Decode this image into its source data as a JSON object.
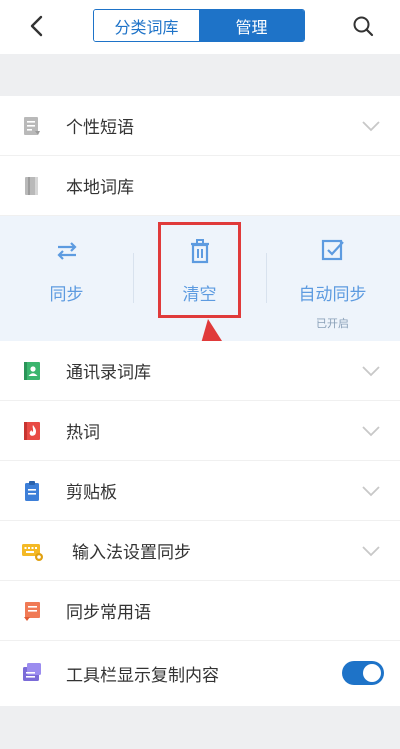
{
  "header": {
    "tabs": [
      {
        "label": "分类词库",
        "active": false
      },
      {
        "label": "管理",
        "active": true
      }
    ]
  },
  "rows": {
    "phrases": {
      "label": "个性短语"
    },
    "local_dict": {
      "label": "本地词库"
    },
    "contacts_dict": {
      "label": "通讯录词库"
    },
    "hot_words": {
      "label": "热词"
    },
    "clipboard": {
      "label": "剪贴板"
    },
    "ime_sync": {
      "label": "输入法设置同步"
    },
    "common_phrases": {
      "label": "同步常用语"
    },
    "toolbar_copy": {
      "label": "工具栏显示复制内容",
      "toggle_on": true
    }
  },
  "panel": {
    "sync": {
      "label": "同步"
    },
    "clear": {
      "label": "清空"
    },
    "auto_sync": {
      "label": "自动同步",
      "status": "已开启"
    }
  },
  "colors": {
    "accent": "#1e73c8",
    "panel_text": "#5d9be0",
    "highlight": "#e03a3a"
  }
}
